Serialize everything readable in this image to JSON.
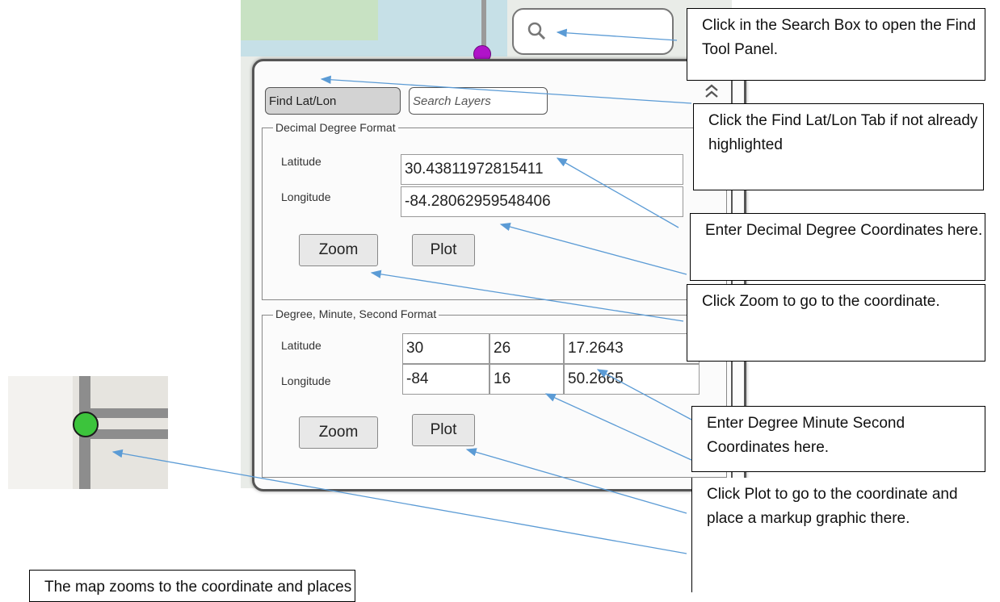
{
  "search": {
    "placeholder": ""
  },
  "tabs": {
    "find_latlon": "Find Lat/Lon",
    "search_layers": "Search Layers"
  },
  "decimal": {
    "legend": "Decimal Degree Format",
    "lat_label": "Latitude",
    "lon_label": "Longitude",
    "lat_value": "30.43811972815411",
    "lon_value": "-84.28062959548406",
    "zoom": "Zoom",
    "plot": "Plot"
  },
  "dms": {
    "legend": "Degree, Minute, Second Format",
    "lat_label": "Latitude",
    "lon_label": "Longitude",
    "lat": [
      "30",
      "26",
      "17.2643"
    ],
    "lon": [
      "-84",
      "16",
      "50.2665"
    ],
    "zoom": "Zoom",
    "plot": "Plot"
  },
  "callouts": {
    "search": "Click in the Search Box to open the Find Tool Panel.",
    "tab": "Click the Find Lat/Lon Tab if not already highlighted",
    "decimal": "Enter Decimal Degree Coordinates here.",
    "zoom": "Click Zoom to go to the coordinate.",
    "dms": "Enter Degree Minute Second Coordinates here.",
    "plot": "Click Plot to go to the coordinate and place a markup graphic there.",
    "map": "The map zooms to the coordinate and places"
  },
  "icons": {
    "search": "magnifier-icon",
    "collapse": "double-chevron-up-icon"
  },
  "colors": {
    "arrow": "#5b9bd5",
    "marker_green": "#3cc43c",
    "pin_purple": "#b013c9"
  }
}
